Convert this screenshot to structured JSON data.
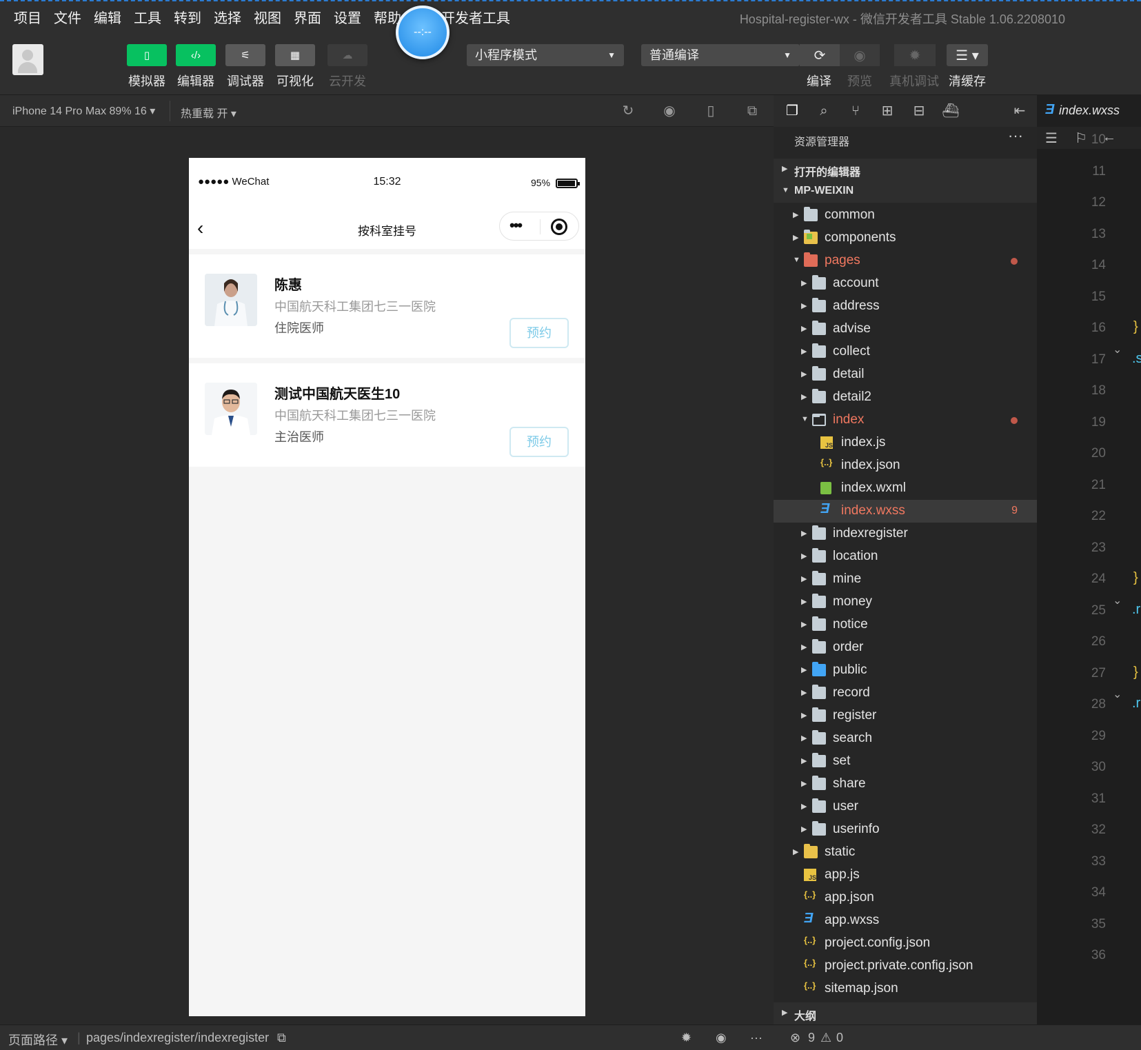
{
  "menu": [
    "项目",
    "文件",
    "编辑",
    "工具",
    "转到",
    "选择",
    "视图",
    "界面",
    "设置",
    "帮助",
    "微信开发者工具"
  ],
  "window_title": "Hospital-register-wx - 微信开发者工具 Stable 1.06.2208010",
  "float_ball_text": "--:--",
  "toolbar": {
    "simulator": "模拟器",
    "editor": "编辑器",
    "debugger": "调试器",
    "visual": "可视化",
    "cloud": "云开发",
    "mode": "小程序模式",
    "compile_mode": "普通编译",
    "compile": "编译",
    "preview": "预览",
    "real_debug": "真机调试",
    "clear_cache": "清缓存"
  },
  "simbar": {
    "device": "iPhone 14 Pro Max 89% 16 ▾",
    "hot_reload": "热重载 开 ▾"
  },
  "phone": {
    "signal": "●●●●● WeChat",
    "time": "15:32",
    "battery_pct": "95%",
    "battery_level": 0.95,
    "nav_title": "按科室挂号",
    "back_icon": "‹",
    "doctors": [
      {
        "name": "陈惠",
        "hospital": "中国航天科工集团七三一医院",
        "rank": "住院医师",
        "book": "预约"
      },
      {
        "name": "测试中国航天医生10",
        "hospital": "中国航天科工集团七三一医院",
        "rank": "主治医师",
        "book": "预约"
      }
    ]
  },
  "explorer": {
    "title": "资源管理器",
    "more": "···",
    "open_editors": "打开的编辑器",
    "project": "MP-WEIXIN",
    "outline": "大纲",
    "tree": [
      {
        "name": "common",
        "kind": "folder",
        "depth": 1,
        "collapsed": true
      },
      {
        "name": "components",
        "kind": "folder-components",
        "depth": 1,
        "collapsed": true
      },
      {
        "name": "pages",
        "kind": "folder-red",
        "depth": 1,
        "collapsed": false,
        "modified": true
      },
      {
        "name": "account",
        "kind": "folder",
        "depth": 2,
        "collapsed": true
      },
      {
        "name": "address",
        "kind": "folder",
        "depth": 2,
        "collapsed": true
      },
      {
        "name": "advise",
        "kind": "folder",
        "depth": 2,
        "collapsed": true
      },
      {
        "name": "collect",
        "kind": "folder",
        "depth": 2,
        "collapsed": true
      },
      {
        "name": "detail",
        "kind": "folder",
        "depth": 2,
        "collapsed": true
      },
      {
        "name": "detail2",
        "kind": "folder",
        "depth": 2,
        "collapsed": true
      },
      {
        "name": "index",
        "kind": "folder-open",
        "depth": 2,
        "collapsed": false,
        "modified": true
      },
      {
        "name": "index.js",
        "kind": "js",
        "depth": 3
      },
      {
        "name": "index.json",
        "kind": "json",
        "depth": 3
      },
      {
        "name": "index.wxml",
        "kind": "wxml",
        "depth": 3
      },
      {
        "name": "index.wxss",
        "kind": "css",
        "depth": 3,
        "selected": true,
        "problems": "9"
      },
      {
        "name": "indexregister",
        "kind": "folder",
        "depth": 2,
        "collapsed": true
      },
      {
        "name": "location",
        "kind": "folder",
        "depth": 2,
        "collapsed": true
      },
      {
        "name": "mine",
        "kind": "folder",
        "depth": 2,
        "collapsed": true
      },
      {
        "name": "money",
        "kind": "folder",
        "depth": 2,
        "collapsed": true
      },
      {
        "name": "notice",
        "kind": "folder",
        "depth": 2,
        "collapsed": true
      },
      {
        "name": "order",
        "kind": "folder",
        "depth": 2,
        "collapsed": true
      },
      {
        "name": "public",
        "kind": "folder-globe",
        "depth": 2,
        "collapsed": true
      },
      {
        "name": "record",
        "kind": "folder",
        "depth": 2,
        "collapsed": true
      },
      {
        "name": "register",
        "kind": "folder",
        "depth": 2,
        "collapsed": true
      },
      {
        "name": "search",
        "kind": "folder",
        "depth": 2,
        "collapsed": true
      },
      {
        "name": "set",
        "kind": "folder",
        "depth": 2,
        "collapsed": true
      },
      {
        "name": "share",
        "kind": "folder",
        "depth": 2,
        "collapsed": true
      },
      {
        "name": "user",
        "kind": "folder",
        "depth": 2,
        "collapsed": true
      },
      {
        "name": "userinfo",
        "kind": "folder",
        "depth": 2,
        "collapsed": true
      },
      {
        "name": "static",
        "kind": "folder-yellow",
        "depth": 1,
        "collapsed": true
      },
      {
        "name": "app.js",
        "kind": "js",
        "depth": 1
      },
      {
        "name": "app.json",
        "kind": "json",
        "depth": 1
      },
      {
        "name": "app.wxss",
        "kind": "css",
        "depth": 1
      },
      {
        "name": "project.config.json",
        "kind": "json",
        "depth": 1
      },
      {
        "name": "project.private.config.json",
        "kind": "json",
        "depth": 1
      },
      {
        "name": "sitemap.json",
        "kind": "json",
        "depth": 1
      }
    ]
  },
  "editor": {
    "tab": "index.wxss",
    "line_numbers": [
      "10",
      "11",
      "12",
      "13",
      "14",
      "15",
      "16",
      "17",
      "18",
      "19",
      "20",
      "21",
      "22",
      "23",
      "24",
      "25",
      "26",
      "27",
      "28",
      "29",
      "30",
      "31",
      "32",
      "33",
      "34",
      "35",
      "36"
    ],
    "code": [
      {
        "line": "16",
        "text": "}"
      },
      {
        "line": "17",
        "text": ".s",
        "fold": true
      },
      {
        "line": "24",
        "text": "}"
      },
      {
        "line": "25",
        "text": ".r",
        "fold": true
      },
      {
        "line": "27",
        "text": "}"
      },
      {
        "line": "28",
        "text": ".r",
        "fold": true
      }
    ]
  },
  "bottom": {
    "page_path_label": "页面路径 ▾",
    "page_path": "pages/indexregister/indexregister",
    "errors": "9",
    "warnings": "0"
  }
}
